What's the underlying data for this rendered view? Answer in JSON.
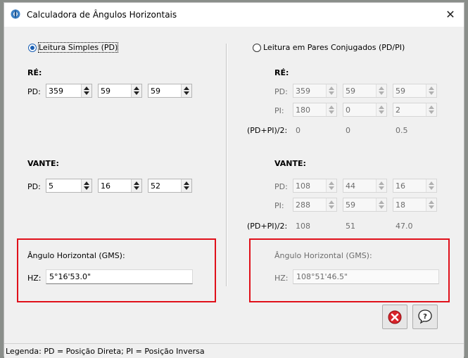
{
  "window": {
    "title": "Calculadora de Ângulos Horizontais",
    "icon": "gear-compass-icon"
  },
  "mode": {
    "simple_label": "Leitura Simples (PD)",
    "pairs_label": "Leitura em Pares Conjugados (PD/PI)",
    "selected": "simple"
  },
  "left": {
    "re_title": "RÉ:",
    "re_pd_label": "PD:",
    "re_pd": [
      "359",
      "59",
      "59"
    ],
    "vante_title": "VANTE:",
    "vante_pd_label": "PD:",
    "vante_pd": [
      "5",
      "16",
      "52"
    ],
    "result_title": "Ângulo Horizontal (GMS):",
    "hz_label": "HZ:",
    "hz_value": "5°16'53.0\""
  },
  "right": {
    "re_title": "RÉ:",
    "pd_label": "PD:",
    "pi_label": "PI:",
    "avg_label": "(PD+PI)/2:",
    "re_pd": [
      "359",
      "59",
      "59"
    ],
    "re_pi": [
      "180",
      "0",
      "2"
    ],
    "re_avg": [
      "0",
      "0",
      "0.5"
    ],
    "vante_title": "VANTE:",
    "vante_pd": [
      "108",
      "44",
      "16"
    ],
    "vante_pi": [
      "288",
      "59",
      "18"
    ],
    "vante_avg": [
      "108",
      "51",
      "47.0"
    ],
    "result_title": "Ângulo Horizontal (GMS):",
    "hz_label": "HZ:",
    "hz_value": "108°51'46.5\""
  },
  "buttons": {
    "close_icon": "red-x-icon",
    "help_icon": "question-icon"
  },
  "status": {
    "legend": "Legenda: PD = Posição Direta; PI = Posição Inversa"
  },
  "colors": {
    "highlight": "#e0101a",
    "radio": "#1a5fb4"
  }
}
